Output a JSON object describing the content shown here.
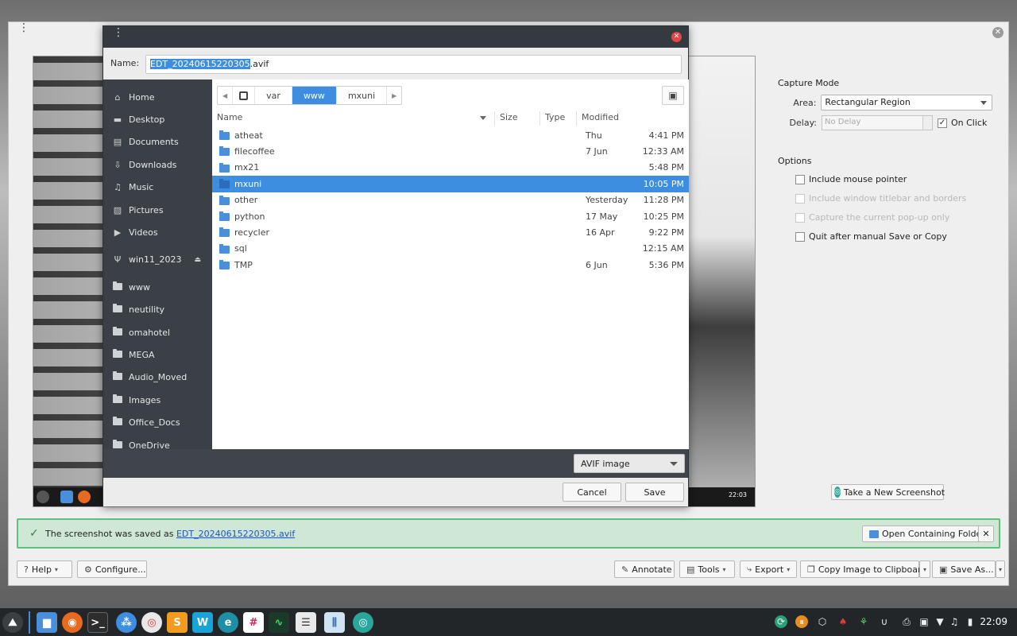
{
  "spectacle": {
    "preview_clock": "22:03",
    "capture_mode": {
      "title": "Capture Mode",
      "area_label": "Area:",
      "area_value": "Rectangular Region",
      "delay_label": "Delay:",
      "delay_value": "No Delay",
      "on_click_label": "On Click",
      "on_click_checked": true
    },
    "options": {
      "title": "Options",
      "items": [
        {
          "label": "Include mouse pointer",
          "enabled": true,
          "checked": false
        },
        {
          "label": "Include window titlebar and borders",
          "enabled": false,
          "checked": false
        },
        {
          "label": "Capture the current pop-up only",
          "enabled": false,
          "checked": false
        },
        {
          "label": "Quit after manual Save or Copy",
          "enabled": true,
          "checked": false
        }
      ]
    },
    "take_screenshot_label": "Take a New Screenshot",
    "notice": {
      "prefix": "The screenshot was saved as ",
      "filename": "EDT_20240615220305.avif",
      "open_folder_label": "Open Containing Folder",
      "close_label": "✕"
    },
    "bottom_bar": {
      "help": "Help",
      "configure": "Configure...",
      "annotate": "Annotate",
      "tools": "Tools",
      "export": "Export",
      "copy_clipboard": "Copy Image to Clipboard",
      "save_as": "Save As..."
    }
  },
  "dialog": {
    "name_label": "Name:",
    "name_selected": "EDT_20240615220305",
    "name_ext": ".avif",
    "places": [
      {
        "label": "Home",
        "icon": "home-icon"
      },
      {
        "label": "Desktop",
        "icon": "desktop-icon"
      },
      {
        "label": "Documents",
        "icon": "documents-icon"
      },
      {
        "label": "Downloads",
        "icon": "downloads-icon"
      },
      {
        "label": "Music",
        "icon": "music-icon"
      },
      {
        "label": "Pictures",
        "icon": "pictures-icon"
      },
      {
        "label": "Videos",
        "icon": "videos-icon"
      },
      {
        "label": "win11_2023",
        "icon": "usb-drive-icon"
      },
      {
        "label": "www",
        "icon": "folder-icon"
      },
      {
        "label": "neutility",
        "icon": "folder-icon"
      },
      {
        "label": "omahotel",
        "icon": "folder-icon"
      },
      {
        "label": "MEGA",
        "icon": "folder-icon"
      },
      {
        "label": "Audio_Moved",
        "icon": "folder-icon"
      },
      {
        "label": "Images",
        "icon": "folder-icon"
      },
      {
        "label": "Office_Docs",
        "icon": "folder-icon"
      },
      {
        "label": "OneDrive",
        "icon": "folder-icon"
      }
    ],
    "path": [
      "var",
      "www",
      "mxuni"
    ],
    "columns": {
      "name": "Name",
      "size": "Size",
      "type": "Type",
      "modified": "Modified"
    },
    "files": [
      {
        "name": "atheat",
        "date": "Thu",
        "time": "4:41 PM"
      },
      {
        "name": "filecoffee",
        "date": "7 Jun",
        "time": "12:33 AM"
      },
      {
        "name": "mx21",
        "date": "",
        "time": "5:48 PM"
      },
      {
        "name": "mxuni",
        "date": "",
        "time": "10:05 PM"
      },
      {
        "name": "other",
        "date": "Yesterday",
        "time": "11:28 PM"
      },
      {
        "name": "python",
        "date": "17 May",
        "time": "10:25 PM"
      },
      {
        "name": "recycler",
        "date": "16 Apr",
        "time": "9:22 PM"
      },
      {
        "name": "sql",
        "date": "",
        "time": "12:15 AM"
      },
      {
        "name": "TMP",
        "date": "6 Jun",
        "time": "5:36 PM"
      }
    ],
    "selected_file": "mxuni",
    "filter": "AVIF image",
    "cancel_label": "Cancel",
    "save_label": "Save"
  },
  "taskbar": {
    "clock": "22:09"
  }
}
